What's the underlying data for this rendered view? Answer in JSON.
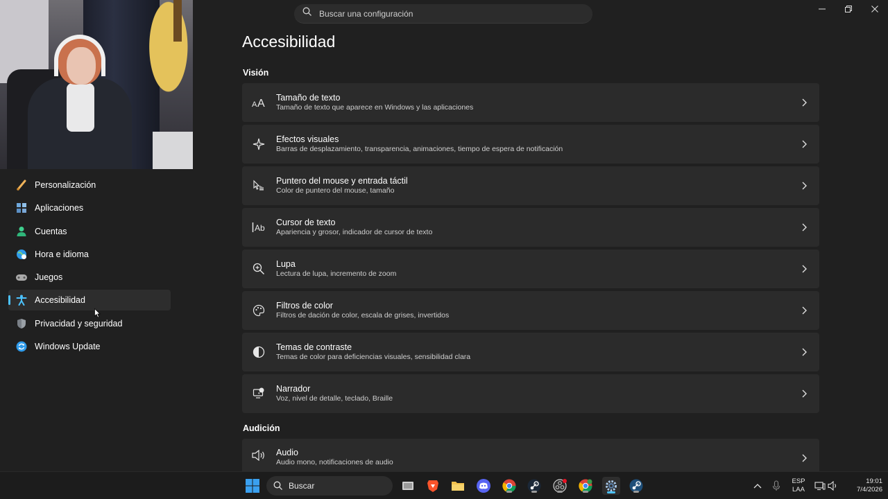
{
  "search": {
    "placeholder": "Buscar una configuración"
  },
  "page": {
    "title": "Accesibilidad"
  },
  "sidebar": {
    "items": [
      {
        "label": "Personalización",
        "icon": "brush-icon",
        "color": "#f0b35a"
      },
      {
        "label": "Aplicaciones",
        "icon": "apps-icon",
        "color": "#6fa8dc"
      },
      {
        "label": "Cuentas",
        "icon": "account-icon",
        "color": "#3fcf8e"
      },
      {
        "label": "Hora e idioma",
        "icon": "globe-clock-icon",
        "color": "#4cc2ff"
      },
      {
        "label": "Juegos",
        "icon": "gamepad-icon",
        "color": "#a0a0a0"
      },
      {
        "label": "Accesibilidad",
        "icon": "accessibility-icon",
        "color": "#4cc2ff",
        "active": true
      },
      {
        "label": "Privacidad y seguridad",
        "icon": "shield-icon",
        "color": "#9aa0a6"
      },
      {
        "label": "Windows Update",
        "icon": "update-icon",
        "color": "#2f9bea"
      }
    ]
  },
  "sections": {
    "vision": "Visión",
    "audicion": "Audición"
  },
  "cards": [
    {
      "title": "Tamaño de texto",
      "sub": "Tamaño de texto que aparece en Windows y las aplicaciones",
      "icon": "text-size-icon"
    },
    {
      "title": "Efectos visuales",
      "sub": "Barras de desplazamiento, transparencia, animaciones, tiempo de espera de notificación",
      "icon": "sparkle-icon"
    },
    {
      "title": "Puntero del mouse y entrada táctil",
      "sub": "Color de puntero del mouse, tamaño",
      "icon": "pointer-touch-icon"
    },
    {
      "title": "Cursor de texto",
      "sub": "Apariencia y grosor, indicador de cursor de texto",
      "icon": "text-cursor-icon"
    },
    {
      "title": "Lupa",
      "sub": "Lectura de lupa, incremento de zoom",
      "icon": "magnifier-icon"
    },
    {
      "title": "Filtros de color",
      "sub": "Filtros de dación de color, escala de grises, invertidos",
      "icon": "palette-icon"
    },
    {
      "title": "Temas de contraste",
      "sub": "Temas de color para deficiencias visuales, sensibilidad clara",
      "icon": "contrast-icon"
    },
    {
      "title": "Narrador",
      "sub": "Voz, nivel de detalle, teclado, Braille",
      "icon": "narrator-icon"
    },
    {
      "title": "Audio",
      "sub": "Audio mono, notificaciones de audio",
      "icon": "speaker-icon"
    }
  ],
  "taskbar": {
    "search_label": "Buscar",
    "lang_top": "ESP",
    "lang_bottom": "LAA",
    "time": "19:01",
    "date": "7/4/2026"
  },
  "colors": {
    "accent": "#4cc2ff",
    "background": "#202020",
    "card": "#2b2b2b"
  }
}
